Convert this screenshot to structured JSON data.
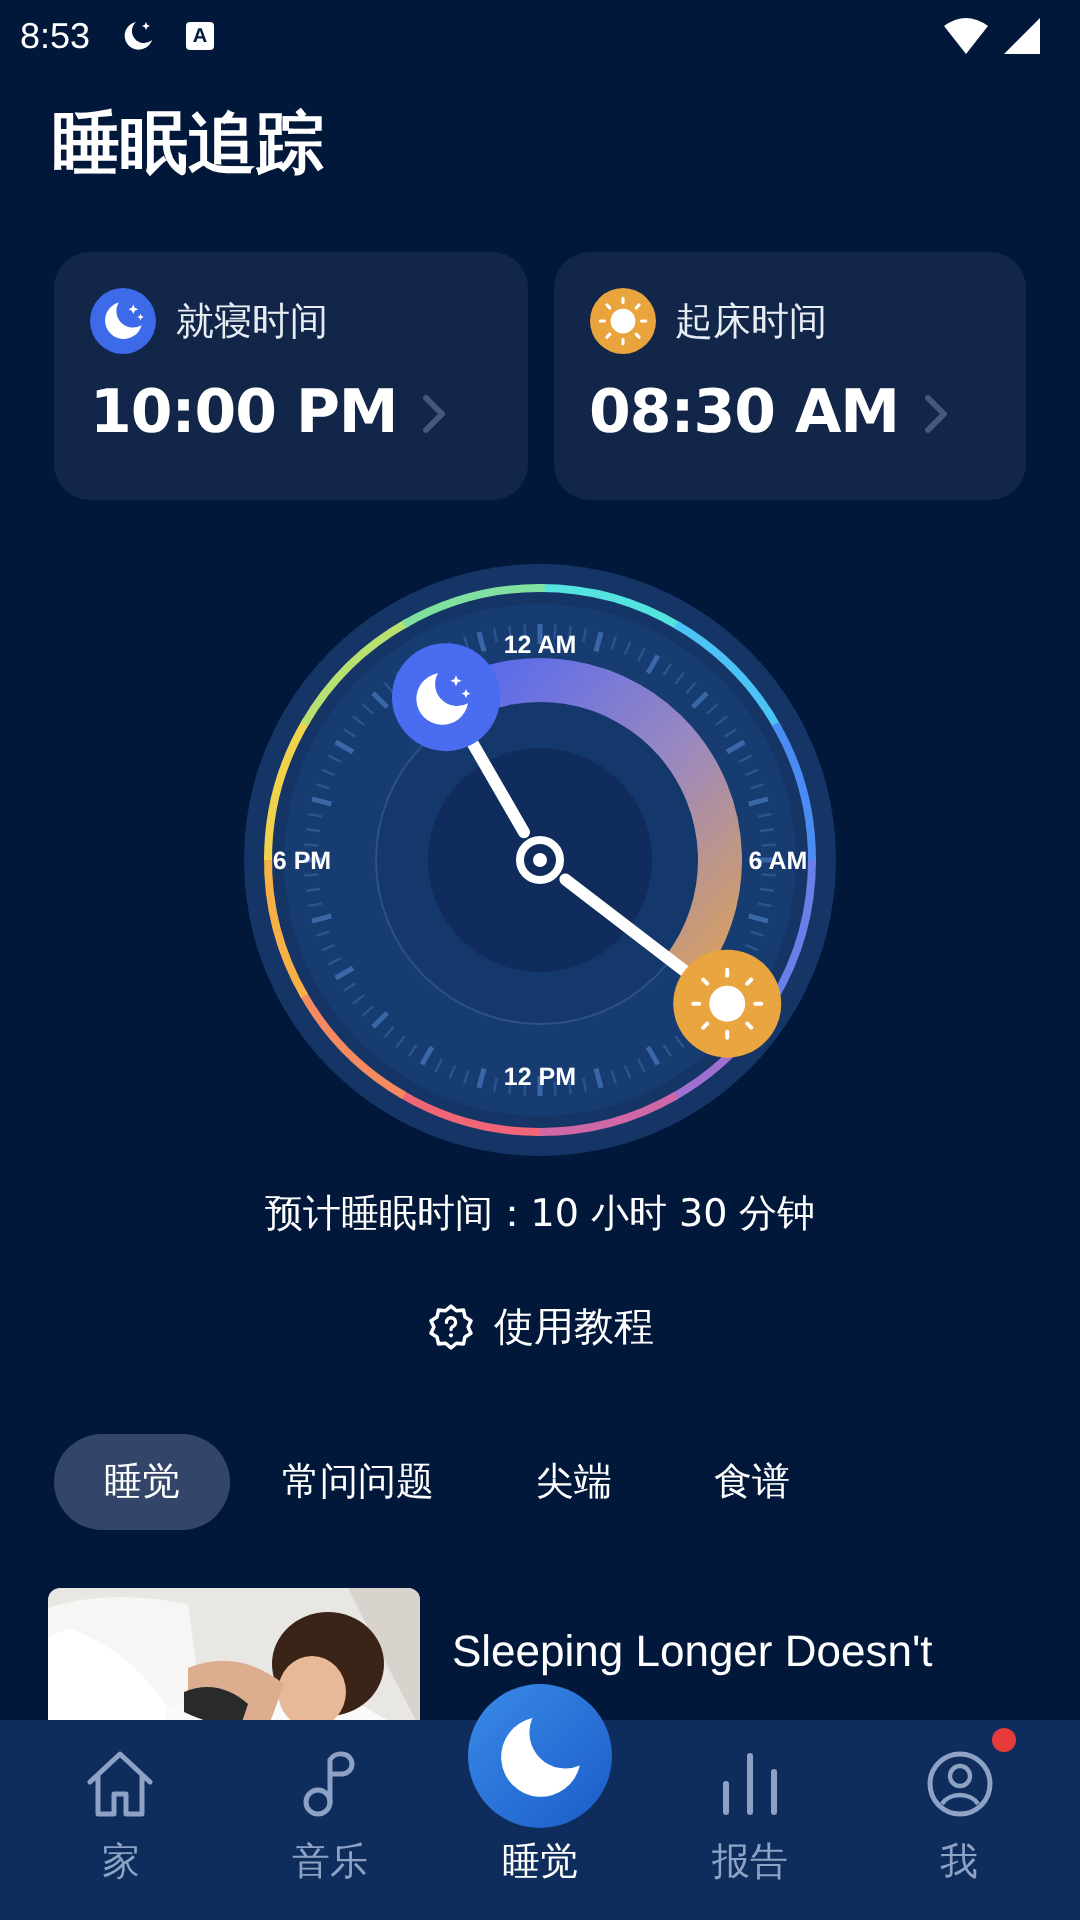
{
  "status_bar": {
    "time": "8:53",
    "app_badge": "A"
  },
  "title": "睡眠追踪",
  "time_cards": [
    {
      "kind": "bedtime",
      "label": "就寝时间",
      "time": "10:00 PM"
    },
    {
      "kind": "wake",
      "label": "起床时间",
      "time": "08:30 AM"
    }
  ],
  "dial": {
    "labels": [
      "12 AM",
      "6 AM",
      "12 PM",
      "6 PM"
    ]
  },
  "estimate": "预计睡眠时间：10 小时 30 分钟",
  "tutorial": "使用教程",
  "tabs": [
    {
      "label": "睡觉",
      "selected": true
    },
    {
      "label": "常问问题",
      "selected": false
    },
    {
      "label": "尖端",
      "selected": false
    },
    {
      "label": "食谱",
      "selected": false
    }
  ],
  "article": {
    "title": "Sleeping Longer Doesn't"
  },
  "nav": [
    {
      "kind": "home",
      "label": "家",
      "selected": false,
      "badge": false
    },
    {
      "kind": "music",
      "label": "音乐",
      "selected": false,
      "badge": false
    },
    {
      "kind": "sleep",
      "label": "睡觉",
      "selected": true,
      "badge": false
    },
    {
      "kind": "report",
      "label": "报告",
      "selected": false,
      "badge": false
    },
    {
      "kind": "me",
      "label": "我",
      "selected": false,
      "badge": true
    }
  ]
}
